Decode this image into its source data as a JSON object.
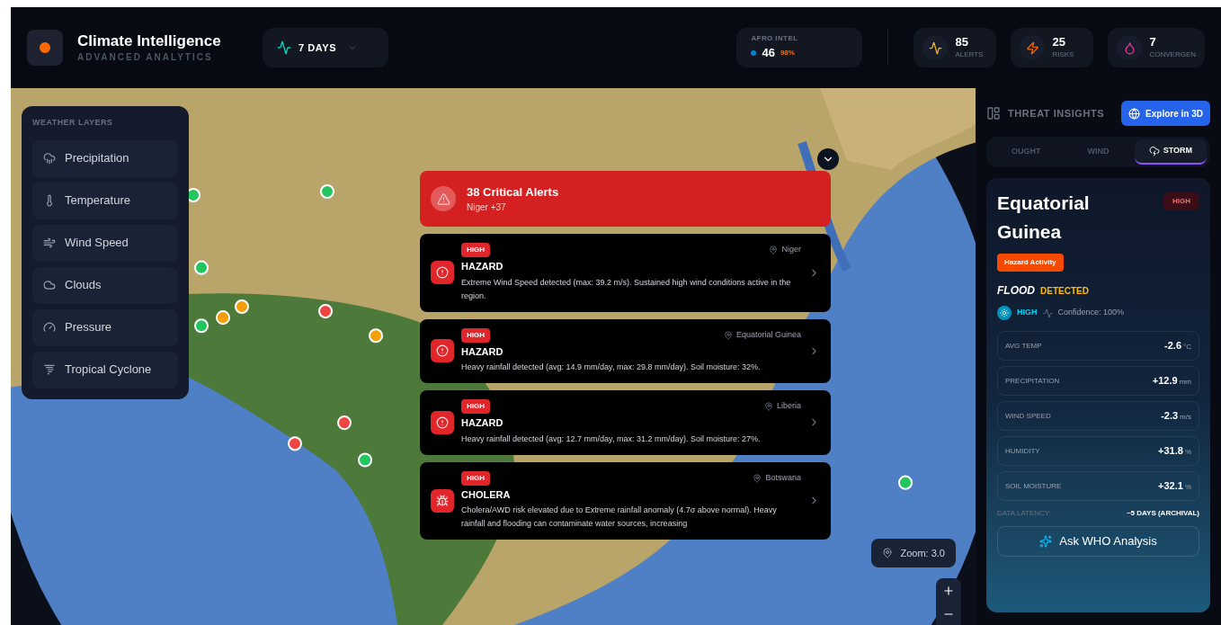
{
  "app": {
    "title": "Climate Intelligence",
    "subtitle": "ADVANCED ANALYTICS"
  },
  "range": {
    "label": "7 DAYS"
  },
  "afro": {
    "label": "AFRO INTEL",
    "value": "46",
    "percent": "98%"
  },
  "stats": [
    {
      "kind": "alerts",
      "value": "85",
      "label": "ALERTS"
    },
    {
      "kind": "risks",
      "value": "25",
      "label": "RISKS"
    },
    {
      "kind": "convergent",
      "value": "7",
      "label": "CONVERGEN"
    }
  ],
  "layers": {
    "title": "WEATHER LAYERS",
    "items": [
      {
        "kind": "precipitation",
        "label": "Precipitation"
      },
      {
        "kind": "temperature",
        "label": "Temperature"
      },
      {
        "kind": "wind",
        "label": "Wind Speed"
      },
      {
        "kind": "clouds",
        "label": "Clouds"
      },
      {
        "kind": "pressure",
        "label": "Pressure"
      },
      {
        "kind": "cyclone",
        "label": "Tropical Cyclone"
      }
    ]
  },
  "alerts": {
    "title": "38 Critical Alerts",
    "subtitle": "Niger +37",
    "items": [
      {
        "kind": "hazard",
        "severity": "HIGH",
        "title": "HAZARD",
        "location": "Niger",
        "text": "Extreme Wind Speed detected (max: 39.2 m/s). Sustained high wind conditions active in the region."
      },
      {
        "kind": "hazard",
        "severity": "HIGH",
        "title": "HAZARD",
        "location": "Equatorial Guinea",
        "text": "Heavy rainfall detected (avg: 14.9 mm/day, max: 29.8 mm/day). Soil moisture: 32%."
      },
      {
        "kind": "hazard",
        "severity": "HIGH",
        "title": "HAZARD",
        "location": "Liberia",
        "text": "Heavy rainfall detected (avg: 12.7 mm/day, max: 31.2 mm/day). Soil moisture: 27%."
      },
      {
        "kind": "cholera",
        "severity": "HIGH",
        "title": "CHOLERA",
        "location": "Botswana",
        "text": "Cholera/AWD risk elevated due to Extreme rainfall anomaly (4.7σ above normal). Heavy rainfall and flooding can contaminate water sources, increasing"
      }
    ]
  },
  "zoom": {
    "label": "Zoom: 3.0"
  },
  "insights": {
    "title": "THREAT INSIGHTS",
    "explore": "Explore in 3D",
    "tabs": [
      {
        "label": "OUGHT",
        "selected": false
      },
      {
        "label": "WIND",
        "selected": false
      },
      {
        "label": "STORM",
        "selected": true
      }
    ],
    "region": "Equatorial Guinea",
    "severity": "HIGH",
    "tag": "Hazard Activity",
    "event": "FLOOD",
    "status": "DETECTED",
    "level": "HIGH",
    "confidence": "Confidence: 100%",
    "metrics": [
      {
        "label": "AVG TEMP",
        "value": "-2.6",
        "unit": "°C"
      },
      {
        "label": "PRECIPITATION",
        "value": "+12.9",
        "unit": "mm"
      },
      {
        "label": "WIND SPEED",
        "value": "-2.3",
        "unit": "m/s"
      },
      {
        "label": "HUMIDITY",
        "value": "+31.8",
        "unit": "%"
      },
      {
        "label": "SOIL MOISTURE",
        "value": "+32.1",
        "unit": "%"
      }
    ],
    "latency_label": "DATA LATENCY:",
    "latency_value": "~5 DAYS (ARCHIVAL)",
    "ask": "Ask WHO Analysis"
  }
}
